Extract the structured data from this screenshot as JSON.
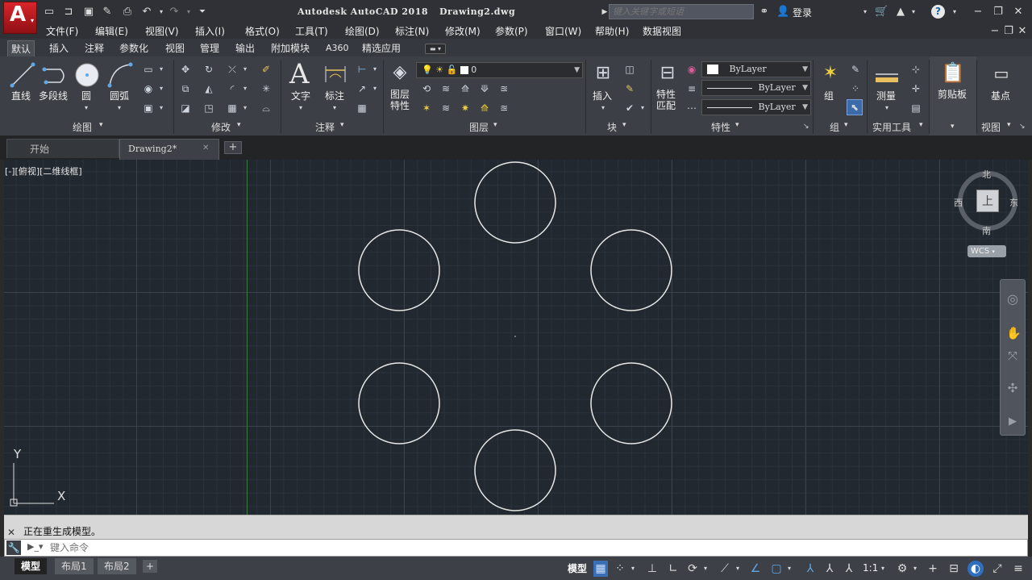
{
  "app": {
    "title": "Autodesk AutoCAD 2018",
    "document": "Drawing2.dwg",
    "search_placeholder": "键入关键字或短语",
    "login": "登录"
  },
  "menubar": [
    "文件(F)",
    "编辑(E)",
    "视图(V)",
    "插入(I)",
    "格式(O)",
    "工具(T)",
    "绘图(D)",
    "标注(N)",
    "修改(M)",
    "参数(P)",
    "窗口(W)",
    "帮助(H)",
    "数据视图"
  ],
  "ribbon_tabs": [
    "默认",
    "插入",
    "注释",
    "参数化",
    "视图",
    "管理",
    "输出",
    "附加模块",
    "A360",
    "精选应用"
  ],
  "ribbon": {
    "draw": {
      "title": "绘图",
      "line": "直线",
      "polyline": "多段线",
      "circle": "圆",
      "arc": "圆弧"
    },
    "modify": {
      "title": "修改"
    },
    "annotation": {
      "title": "注释",
      "text": "文字",
      "dimension": "标注",
      "text_icon": "A"
    },
    "layers": {
      "title": "图层",
      "layer_props": "图层\n特性",
      "current_layer": "0"
    },
    "block": {
      "title": "块",
      "insert": "插入"
    },
    "properties": {
      "title": "特性",
      "match": "特性\n匹配",
      "color": "ByLayer",
      "linetype": "ByLayer",
      "lineweight": "ByLayer"
    },
    "groups": {
      "title": "组",
      "group": "组"
    },
    "utilities": {
      "title": "实用工具",
      "measure": "测量"
    },
    "clipboard": {
      "paste": "剪贴板"
    },
    "view": {
      "title": "视图",
      "base": "基点"
    }
  },
  "filetabs": [
    "开始",
    "Drawing2*"
  ],
  "viewport": {
    "label": "[-][俯视][二维线框]",
    "viewcube": {
      "north": "北",
      "south": "南",
      "east": "东",
      "west": "西",
      "top": "上",
      "wcs": "WCS"
    },
    "ucs": {
      "x": "X",
      "y": "Y"
    }
  },
  "command": {
    "history": "正在重生成模型。",
    "placeholder": "键入命令"
  },
  "layout_tabs": [
    "模型",
    "布局1",
    "布局2"
  ],
  "status": {
    "model": "模型",
    "scale": "1:1"
  },
  "colors": {
    "canvas": "#212830",
    "accent": "#c8102e",
    "circle": "#e8e8e8"
  }
}
